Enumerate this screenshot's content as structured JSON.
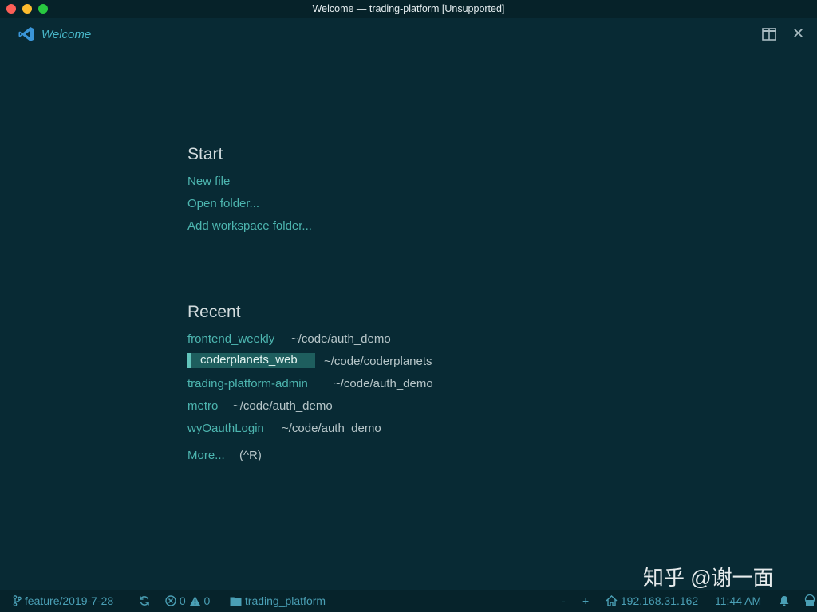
{
  "window": {
    "title": "Welcome — trading-platform [Unsupported]"
  },
  "tab": {
    "title": "Welcome"
  },
  "start": {
    "heading": "Start",
    "new_file": "New file",
    "open_folder": "Open folder...",
    "add_workspace_folder": "Add workspace folder..."
  },
  "recent": {
    "heading": "Recent",
    "items": [
      {
        "name": "frontend_weekly",
        "path": "~/code/auth_demo"
      },
      {
        "name": "coderplanets_web",
        "path": "~/code/coderplanets",
        "selected": true
      },
      {
        "name": "trading-platform-admin",
        "path": "~/code/auth_demo"
      },
      {
        "name": "metro",
        "path": "~/code/auth_demo"
      },
      {
        "name": "wyOauthLogin",
        "path": "~/code/auth_demo"
      }
    ],
    "more_label": "More...",
    "more_shortcut": "(^R)"
  },
  "status": {
    "branch": "feature/2019-7-28",
    "errors": "0",
    "warnings": "0",
    "folder": "trading_platform",
    "zoom_out": "-",
    "zoom_in": "+",
    "host": "192.168.31.162",
    "time": "11:44 AM"
  },
  "watermark": "知乎 @谢一面",
  "colors": {
    "background": "#082a34",
    "link": "#4db6b0",
    "status_text": "#4a9fb5",
    "selection": "#1e5e5e"
  },
  "icons": [
    "vscode-logo-icon",
    "split-editor-icon",
    "close-icon",
    "git-branch-icon",
    "sync-icon",
    "error-icon",
    "warning-icon",
    "folder-icon",
    "home-icon",
    "bell-icon",
    "feedback-icon"
  ]
}
